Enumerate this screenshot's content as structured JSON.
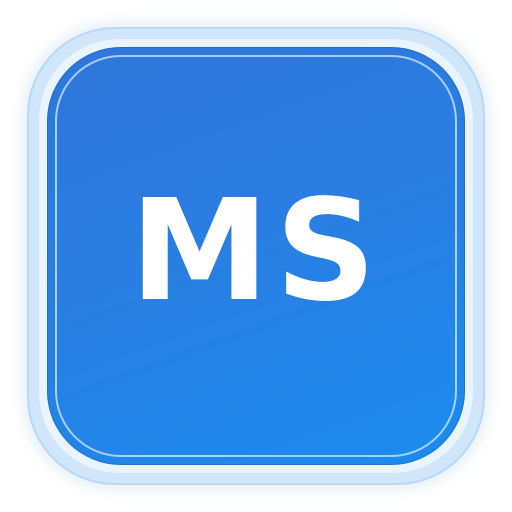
{
  "app_icon": {
    "label": "MS",
    "colors": {
      "tile_top": "#2f76db",
      "tile_bottom": "#1b8bee",
      "frame": "#cfe6fb",
      "text": "#ffffff"
    }
  }
}
